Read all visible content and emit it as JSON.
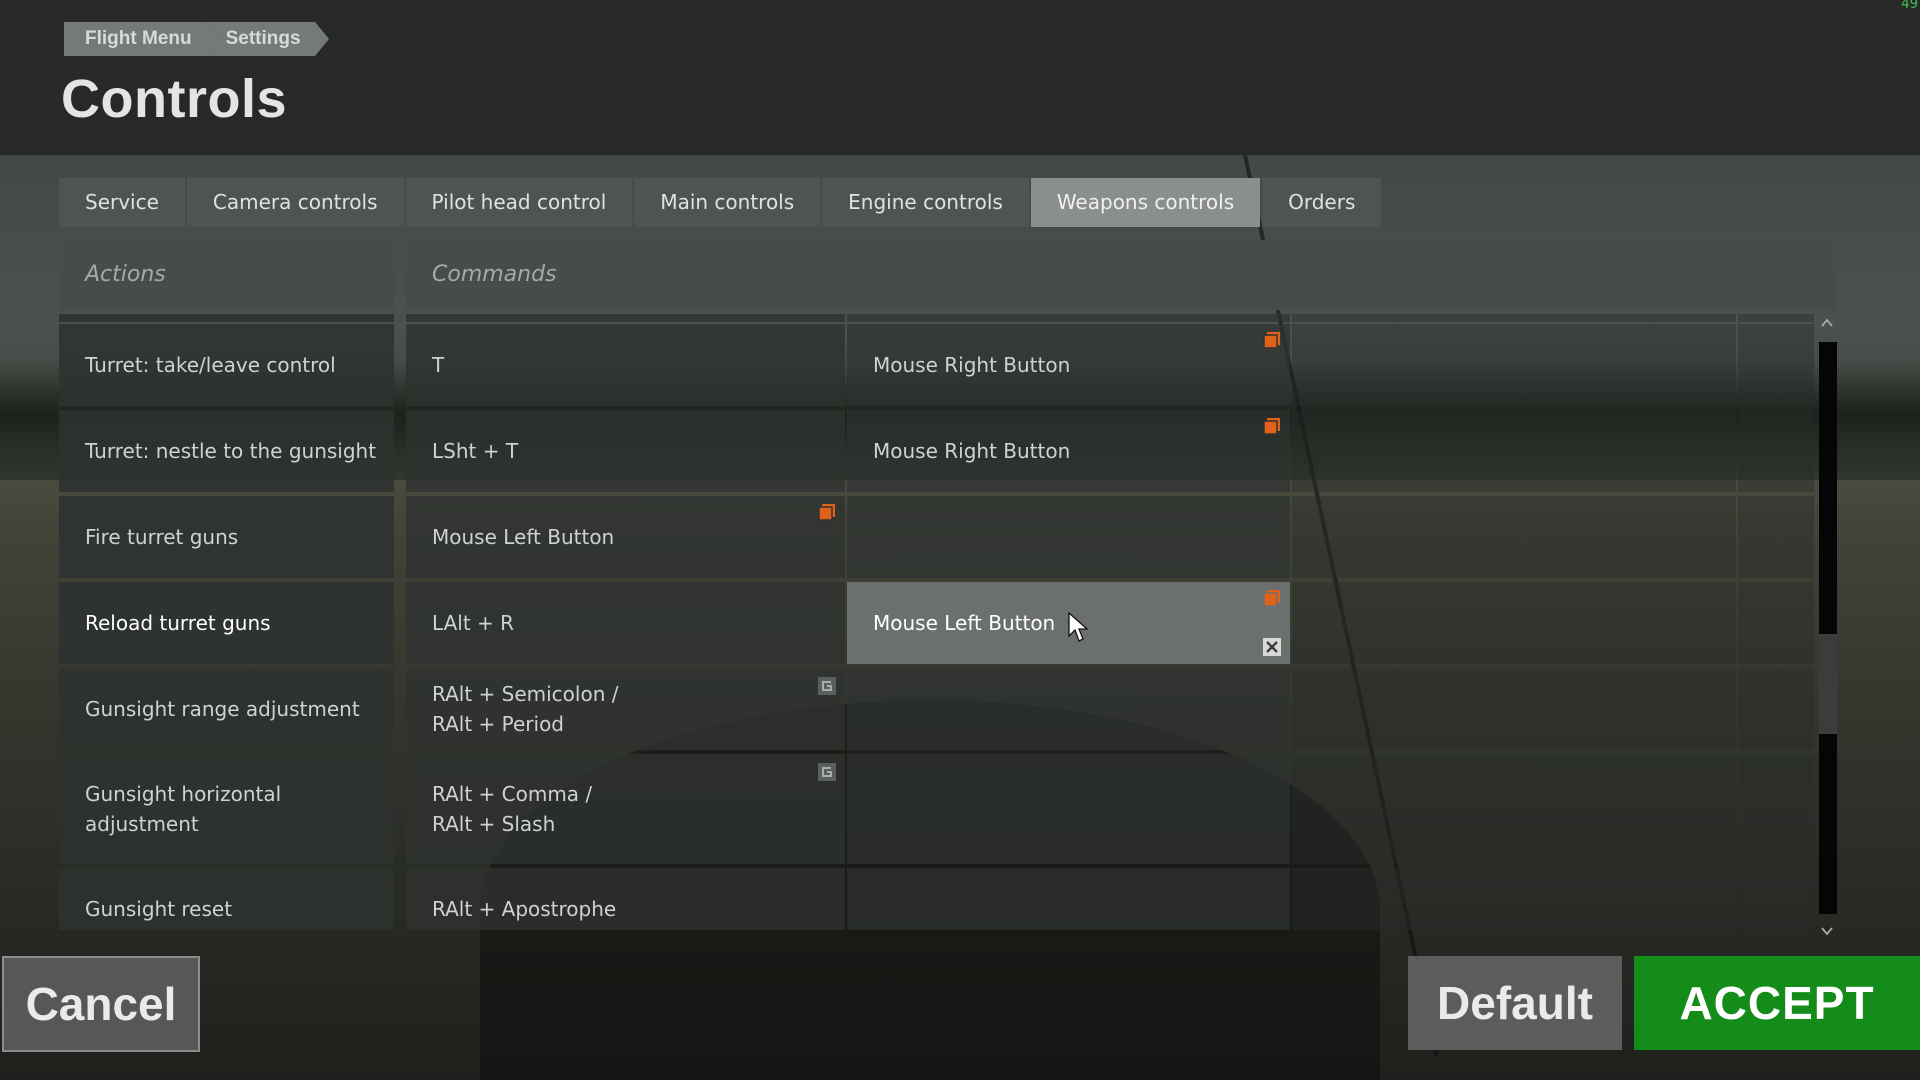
{
  "fps": "49",
  "breadcrumb": [
    "Flight Menu",
    "Settings"
  ],
  "page_title": "Controls",
  "tabs": [
    {
      "label": "Service",
      "active": false
    },
    {
      "label": "Camera controls",
      "active": false
    },
    {
      "label": "Pilot head control",
      "active": false
    },
    {
      "label": "Main controls",
      "active": false
    },
    {
      "label": "Engine controls",
      "active": false
    },
    {
      "label": "Weapons controls",
      "active": true
    },
    {
      "label": "Orders",
      "active": false
    }
  ],
  "table": {
    "header_actions": "Actions",
    "header_commands": "Commands",
    "rows": [
      {
        "action": "Turret: take/leave control",
        "bind1": "T",
        "bind2": "Mouse Right Button"
      },
      {
        "action": "Turret: nestle to the gunsight",
        "bind1": "LSht + T",
        "bind2": "Mouse Right Button"
      },
      {
        "action": "Fire turret guns",
        "bind1": "Mouse Left Button",
        "bind2": ""
      },
      {
        "action": "Reload turret guns",
        "bind1": "LAlt + R",
        "bind2": "Mouse Left Button"
      },
      {
        "action": "Gunsight range adjustment",
        "bind1": "RAlt + Semicolon /\nRAlt + Period",
        "bind2": ""
      },
      {
        "action": "Gunsight horizontal\nadjustment",
        "bind1": "RAlt + Comma /\nRAlt + Slash",
        "bind2": ""
      },
      {
        "action": "Gunsight reset",
        "bind1": "RAlt + Apostrophe",
        "bind2": ""
      }
    ]
  },
  "buttons": {
    "cancel": "Cancel",
    "default": "Default",
    "accept": "ACCEPT"
  },
  "colors": {
    "accent_orange": "#e0621a",
    "accept_green": "#138c1a",
    "active_tab": "#8a8e8c"
  },
  "icons": {
    "copy": "copy-binding-icon",
    "reset": "reset-binding-icon",
    "close": "clear-binding-icon"
  }
}
